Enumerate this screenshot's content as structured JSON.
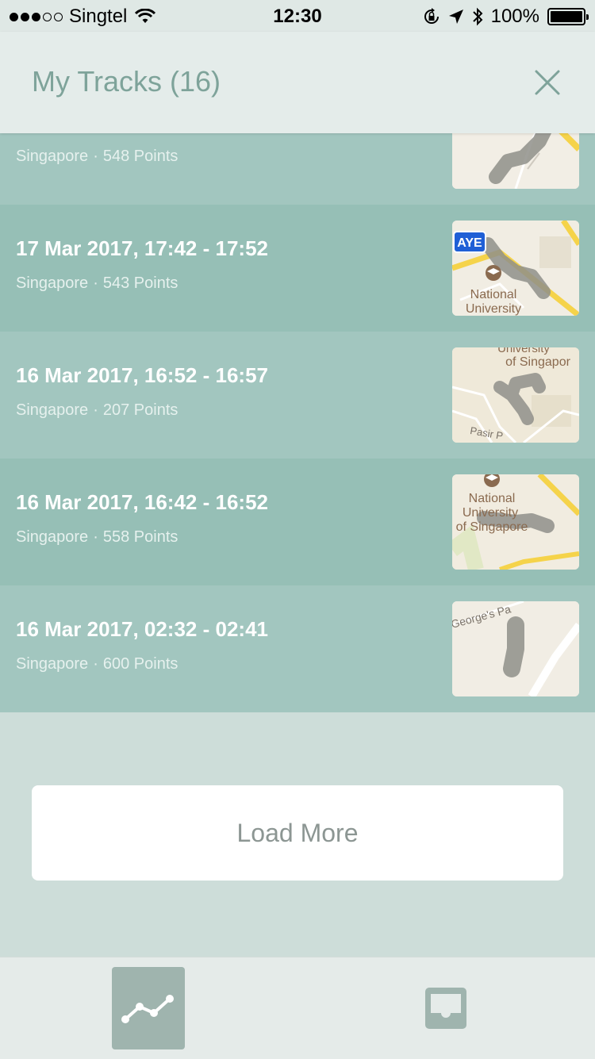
{
  "status_bar": {
    "carrier": "Singtel",
    "time": "12:30",
    "battery": "100%"
  },
  "header": {
    "title": "My Tracks (16)"
  },
  "tracks": [
    {
      "date": "",
      "location": "Singapore",
      "points": "548 Points"
    },
    {
      "date": "17 Mar 2017, 17:42 - 17:52",
      "location": "Singapore",
      "points": "543 Points"
    },
    {
      "date": "16 Mar 2017, 16:52 - 16:57",
      "location": "Singapore",
      "points": "207 Points"
    },
    {
      "date": "16 Mar 2017, 16:42 - 16:52",
      "location": "Singapore",
      "points": "558 Points"
    },
    {
      "date": "16 Mar 2017, 02:32 - 02:41",
      "location": "Singapore",
      "points": "600 Points"
    }
  ],
  "map_labels": {
    "aye": "AYE",
    "national": "National",
    "university": "University",
    "university_of_singapore_a": "University",
    "of_singapore": "of Singapor",
    "pasir": "Pasir P",
    "national_b": "National",
    "university_b": "University",
    "of_singapore_b": "of Singapore",
    "georges": "George's Pa"
  },
  "load_more_label": "Load More",
  "tabs": [
    {
      "name": "tracks",
      "icon": "line-chart-icon",
      "active": true
    },
    {
      "name": "inbox",
      "icon": "inbox-icon",
      "active": false
    }
  ],
  "colors": {
    "accent": "#7ea39a",
    "row_light": "#a2c6bf",
    "row_dark": "#96bfb6",
    "background": "#cdddd9"
  }
}
